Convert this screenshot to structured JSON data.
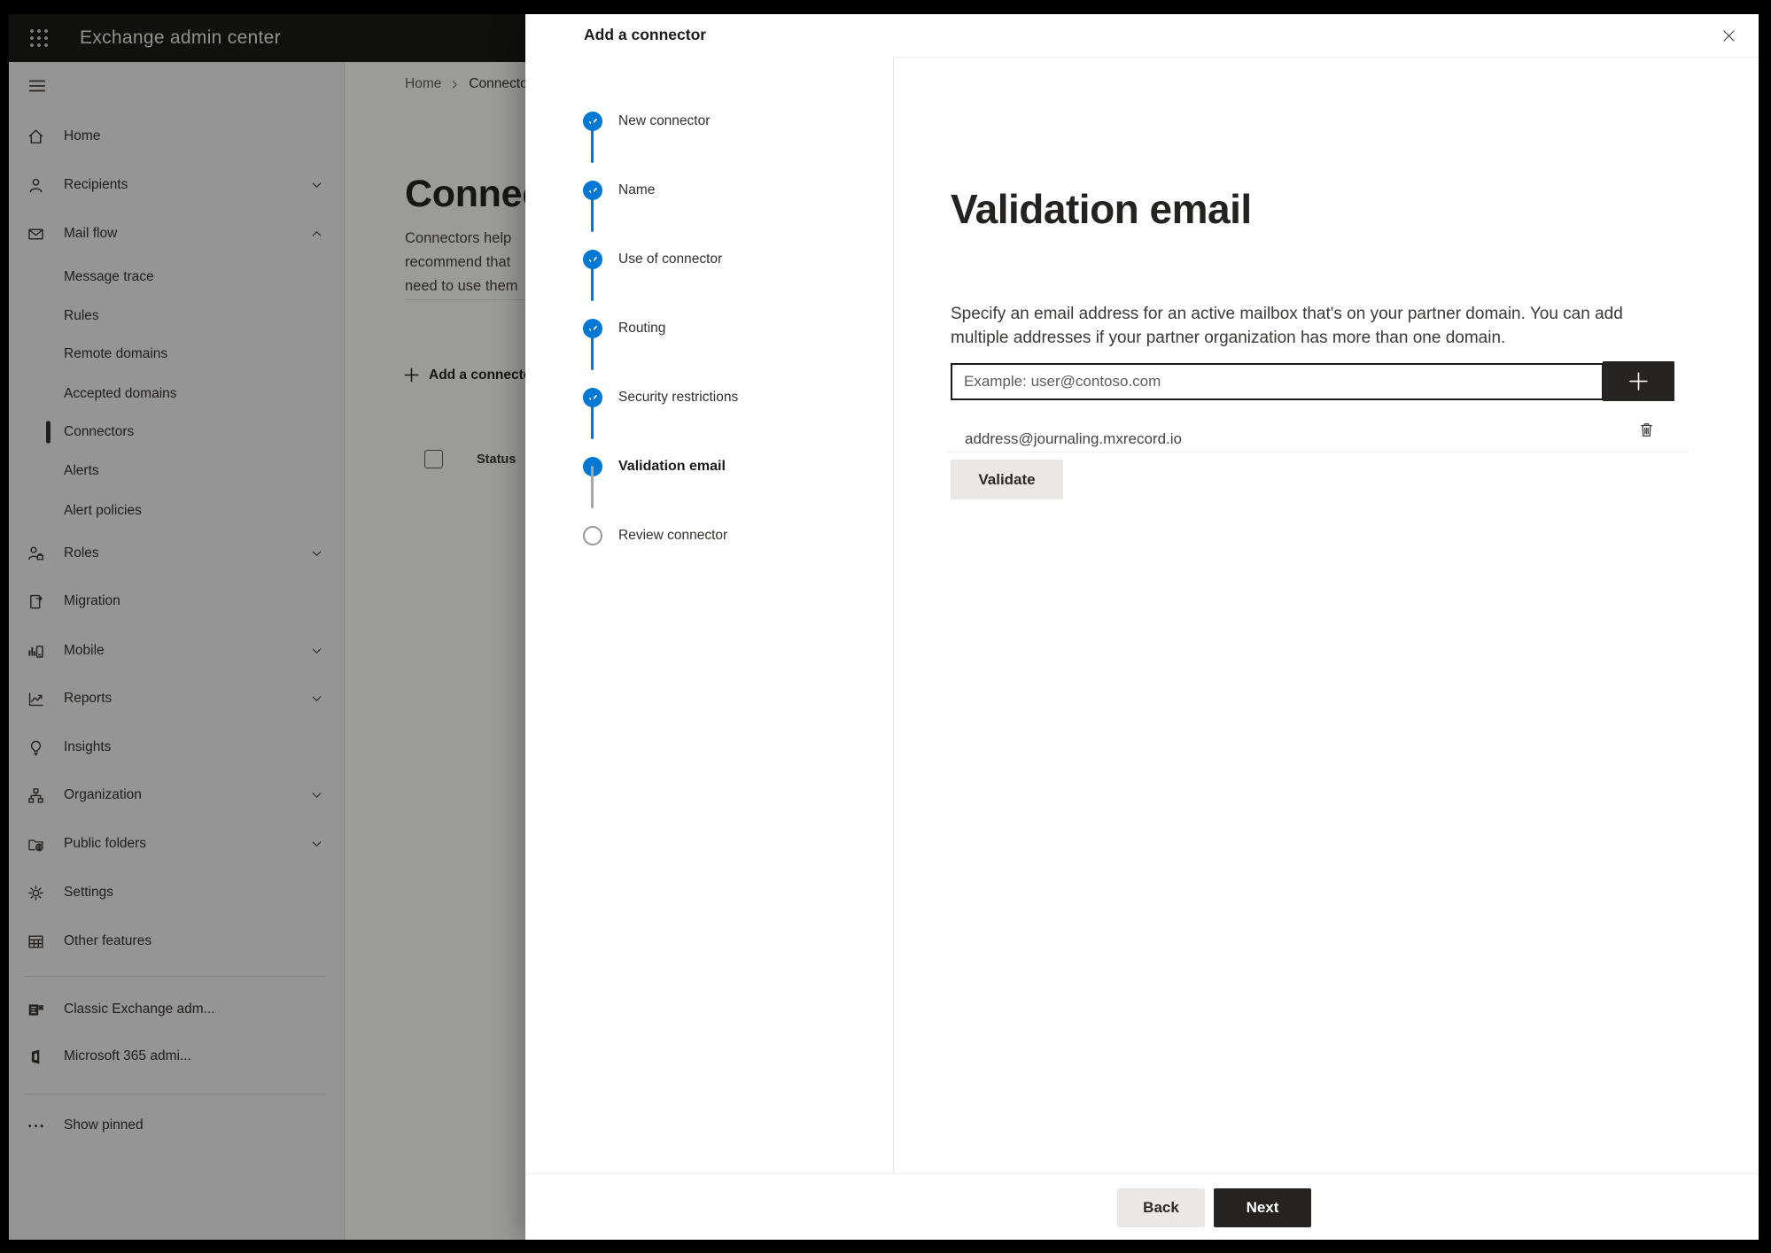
{
  "topbar": {
    "app_title": "Exchange admin center"
  },
  "sidebar": {
    "items": [
      {
        "label": "Home",
        "icon": "home-icon"
      },
      {
        "label": "Recipients",
        "icon": "person-icon",
        "chevron": "down"
      },
      {
        "label": "Mail flow",
        "icon": "mail-icon",
        "chevron": "up",
        "expanded": true
      },
      {
        "label": "Message trace",
        "indent": true
      },
      {
        "label": "Rules",
        "indent": true
      },
      {
        "label": "Remote domains",
        "indent": true
      },
      {
        "label": "Accepted domains",
        "indent": true
      },
      {
        "label": "Connectors",
        "indent": true,
        "selected": true
      },
      {
        "label": "Alerts",
        "indent": true
      },
      {
        "label": "Alert policies",
        "indent": true
      },
      {
        "label": "Roles",
        "icon": "person-badge-icon",
        "chevron": "down"
      },
      {
        "label": "Migration",
        "icon": "migration-icon"
      },
      {
        "label": "Mobile",
        "icon": "mobile-chart-icon",
        "chevron": "down"
      },
      {
        "label": "Reports",
        "icon": "line-chart-icon",
        "chevron": "down"
      },
      {
        "label": "Insights",
        "icon": "lightbulb-icon"
      },
      {
        "label": "Organization",
        "icon": "org-chart-icon",
        "chevron": "down"
      },
      {
        "label": "Public folders",
        "icon": "folder-globe-icon",
        "chevron": "down"
      },
      {
        "label": "Settings",
        "icon": "gear-icon"
      },
      {
        "label": "Other features",
        "icon": "table-icon"
      },
      {
        "label": "Classic Exchange adm...",
        "icon": "exchange-logo-icon"
      },
      {
        "label": "Microsoft 365 admi...",
        "icon": "office-logo-icon"
      },
      {
        "label": "Show pinned",
        "icon": "ellipsis-icon"
      }
    ]
  },
  "page": {
    "breadcrumb": {
      "home": "Home",
      "current": "Connectors"
    },
    "title": "Connectors",
    "intro_lines": [
      "Connectors help",
      "recommend that",
      "need to use them"
    ],
    "add_button_label": "Add a connector",
    "status_column": "Status"
  },
  "modal": {
    "title": "Add a connector",
    "steps": [
      {
        "label": "New connector",
        "state": "done"
      },
      {
        "label": "Name",
        "state": "done"
      },
      {
        "label": "Use of connector",
        "state": "done"
      },
      {
        "label": "Routing",
        "state": "done"
      },
      {
        "label": "Security restrictions",
        "state": "done"
      },
      {
        "label": "Validation email",
        "state": "current"
      },
      {
        "label": "Review connector",
        "state": "todo"
      }
    ],
    "content": {
      "heading": "Validation email",
      "description": "Specify an email address for an active mailbox that's on your partner domain. You can add multiple addresses if your partner organization has more than one domain.",
      "email_input": {
        "value": "",
        "placeholder": "Example: user@contoso.com"
      },
      "addresses": [
        {
          "email": "address@journaling.mxrecord.io"
        }
      ],
      "validate_label": "Validate"
    },
    "footer": {
      "back_label": "Back",
      "next_label": "Next"
    }
  },
  "colors": {
    "accent_blue": "#0078d4",
    "topbar_bg": "#1b1a19",
    "dark_button_bg": "#242322",
    "light_button_bg": "#e9e8e7",
    "sidebar_bg": "#f2f1f0"
  }
}
